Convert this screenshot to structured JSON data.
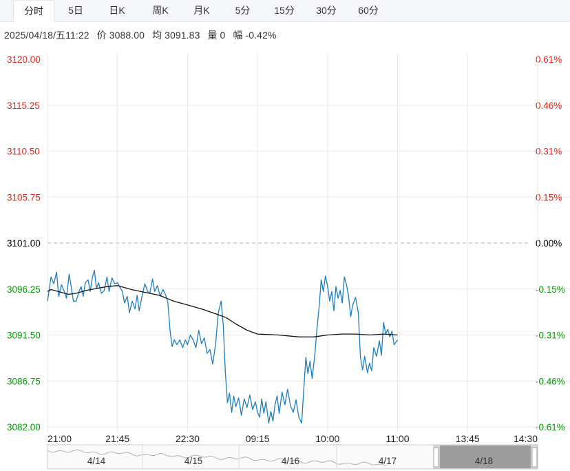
{
  "tabs": [
    {
      "label": "分时",
      "active": true
    },
    {
      "label": "5日",
      "active": false
    },
    {
      "label": "日K",
      "active": false
    },
    {
      "label": "周K",
      "active": false
    },
    {
      "label": "月K",
      "active": false
    },
    {
      "label": "5分",
      "active": false
    },
    {
      "label": "15分",
      "active": false
    },
    {
      "label": "30分",
      "active": false
    },
    {
      "label": "60分",
      "active": false
    }
  ],
  "info": {
    "datetime": "2025/04/18/五11:22",
    "price": "价 3088.00",
    "avg": "均 3091.83",
    "volume": "量 0",
    "change": "幅 -0.42%"
  },
  "colors": {
    "up": "#e2231a",
    "down": "#009900",
    "neutral": "#000000",
    "price_line": "#1a7cc1",
    "avg_line": "#111111",
    "grid": "#e8e8e8"
  },
  "chart_data": {
    "type": "line",
    "prev_close": 3101.0,
    "ylim": [
      3082.0,
      3120.0
    ],
    "y_ticks": [
      "3120.00",
      "3115.25",
      "3110.50",
      "3105.75",
      "3101.00",
      "3096.25",
      "3091.50",
      "3086.75",
      "3082.00"
    ],
    "pct_ticks": [
      "0.61%",
      "0.46%",
      "0.31%",
      "0.15%",
      "0.00%",
      "-0.15%",
      "-0.31%",
      "-0.46%",
      "-0.61%"
    ],
    "x_ticks": [
      "21:00",
      "21:45",
      "22:30",
      "09:15",
      "10:00",
      "11:00",
      "13:45",
      "14:30"
    ],
    "x_slots": [
      "21:00",
      "21:45",
      "22:30",
      "23:00/09:15",
      "10:00",
      "11:00",
      "13:45",
      "14:30"
    ],
    "series": [
      {
        "key": "price",
        "values": [
          [
            0,
            3095.0
          ],
          [
            0.05,
            3097.5
          ],
          [
            0.09,
            3096.8
          ],
          [
            0.13,
            3098.0
          ],
          [
            0.16,
            3095.5
          ],
          [
            0.2,
            3096.7
          ],
          [
            0.24,
            3096.0
          ],
          [
            0.27,
            3095.3
          ],
          [
            0.31,
            3097.8
          ],
          [
            0.34,
            3096.4
          ],
          [
            0.37,
            3095.0
          ],
          [
            0.41,
            3095.0
          ],
          [
            0.45,
            3096.0
          ],
          [
            0.48,
            3096.5
          ],
          [
            0.51,
            3095.5
          ],
          [
            0.54,
            3096.9
          ],
          [
            0.58,
            3097.2
          ],
          [
            0.61,
            3096.0
          ],
          [
            0.64,
            3097.4
          ],
          [
            0.67,
            3098.2
          ],
          [
            0.7,
            3096.3
          ],
          [
            0.73,
            3096.9
          ],
          [
            0.77,
            3095.8
          ],
          [
            0.81,
            3096.1
          ],
          [
            0.85,
            3097.5
          ],
          [
            0.88,
            3096.0
          ],
          [
            0.92,
            3097.4
          ],
          [
            0.96,
            3096.8
          ],
          [
            1.0,
            3096.9
          ],
          [
            1.03,
            3096.5
          ],
          [
            1.07,
            3096.0
          ],
          [
            1.1,
            3094.8
          ],
          [
            1.14,
            3095.5
          ],
          [
            1.17,
            3093.8
          ],
          [
            1.21,
            3095.0
          ],
          [
            1.25,
            3094.2
          ],
          [
            1.28,
            3095.6
          ],
          [
            1.31,
            3094.0
          ],
          [
            1.35,
            3095.5
          ],
          [
            1.39,
            3096.8
          ],
          [
            1.43,
            3096.0
          ],
          [
            1.46,
            3095.8
          ],
          [
            1.5,
            3097.3
          ],
          [
            1.53,
            3096.0
          ],
          [
            1.57,
            3096.6
          ],
          [
            1.61,
            3095.5
          ],
          [
            1.65,
            3096.2
          ],
          [
            1.69,
            3095.6
          ],
          [
            1.72,
            3094.8
          ],
          [
            1.75,
            3092.0
          ],
          [
            1.78,
            3090.3
          ],
          [
            1.81,
            3091.0
          ],
          [
            1.85,
            3090.5
          ],
          [
            1.89,
            3091.0
          ],
          [
            1.93,
            3090.2
          ],
          [
            1.97,
            3091.0
          ],
          [
            2.0,
            3090.5
          ],
          [
            2.04,
            3091.5
          ],
          [
            2.08,
            3091.0
          ],
          [
            2.12,
            3090.2
          ],
          [
            2.16,
            3092.0
          ],
          [
            2.2,
            3090.6
          ],
          [
            2.24,
            3091.2
          ],
          [
            2.28,
            3089.6
          ],
          [
            2.32,
            3090.0
          ],
          [
            2.36,
            3088.5
          ],
          [
            2.4,
            3090.5
          ],
          [
            2.44,
            3093.8
          ],
          [
            2.48,
            3095.0
          ],
          [
            2.51,
            3092.5
          ],
          [
            2.54,
            3087.7
          ],
          [
            2.57,
            3084.5
          ],
          [
            2.6,
            3085.5
          ],
          [
            2.63,
            3083.5
          ],
          [
            2.66,
            3085.2
          ],
          [
            2.69,
            3084.1
          ],
          [
            2.73,
            3085.0
          ],
          [
            2.77,
            3083.2
          ],
          [
            2.81,
            3084.9
          ],
          [
            2.85,
            3084.0
          ],
          [
            2.89,
            3085.3
          ],
          [
            2.93,
            3083.8
          ],
          [
            2.97,
            3084.6
          ],
          [
            3.0,
            3083.5
          ],
          [
            3.03,
            3083.0
          ],
          [
            3.06,
            3084.9
          ],
          [
            3.09,
            3083.4
          ],
          [
            3.12,
            3084.6
          ],
          [
            3.16,
            3082.4
          ],
          [
            3.19,
            3083.6
          ],
          [
            3.22,
            3082.6
          ],
          [
            3.25,
            3084.3
          ],
          [
            3.28,
            3085.2
          ],
          [
            3.31,
            3083.4
          ],
          [
            3.35,
            3085.6
          ],
          [
            3.39,
            3084.3
          ],
          [
            3.43,
            3085.9
          ],
          [
            3.47,
            3084.2
          ],
          [
            3.51,
            3083.5
          ],
          [
            3.55,
            3084.8
          ],
          [
            3.59,
            3083.0
          ],
          [
            3.63,
            3082.4
          ],
          [
            3.66,
            3085.8
          ],
          [
            3.69,
            3089.2
          ],
          [
            3.72,
            3087.5
          ],
          [
            3.75,
            3088.8
          ],
          [
            3.78,
            3087.0
          ],
          [
            3.82,
            3089.6
          ],
          [
            3.85,
            3092.2
          ],
          [
            3.88,
            3094.4
          ],
          [
            3.91,
            3097.2
          ],
          [
            3.94,
            3096.0
          ],
          [
            3.97,
            3097.6
          ],
          [
            4.0,
            3096.6
          ],
          [
            4.03,
            3095.0
          ],
          [
            4.06,
            3096.0
          ],
          [
            4.09,
            3094.0
          ],
          [
            4.12,
            3096.5
          ],
          [
            4.15,
            3095.3
          ],
          [
            4.18,
            3096.1
          ],
          [
            4.21,
            3094.8
          ],
          [
            4.24,
            3097.5
          ],
          [
            4.27,
            3096.7
          ],
          [
            4.3,
            3095.6
          ],
          [
            4.33,
            3093.4
          ],
          [
            4.36,
            3094.6
          ],
          [
            4.4,
            3095.4
          ],
          [
            4.44,
            3093.8
          ],
          [
            4.47,
            3089.2
          ],
          [
            4.5,
            3087.9
          ],
          [
            4.53,
            3089.3
          ],
          [
            4.57,
            3087.6
          ],
          [
            4.6,
            3088.6
          ],
          [
            4.63,
            3087.8
          ],
          [
            4.66,
            3090.2
          ],
          [
            4.7,
            3089.3
          ],
          [
            4.74,
            3090.9
          ],
          [
            4.77,
            3089.4
          ],
          [
            4.8,
            3092.8
          ],
          [
            4.83,
            3091.6
          ],
          [
            4.86,
            3092.1
          ],
          [
            4.89,
            3091.3
          ],
          [
            4.92,
            3091.9
          ],
          [
            4.95,
            3090.5
          ],
          [
            5.0,
            3091.0
          ]
        ]
      },
      {
        "key": "avg",
        "values": [
          [
            0,
            3096.0
          ],
          [
            0.05,
            3096.2
          ],
          [
            0.15,
            3096.0
          ],
          [
            0.3,
            3095.7
          ],
          [
            0.4,
            3095.8
          ],
          [
            0.55,
            3096.1
          ],
          [
            0.7,
            3096.3
          ],
          [
            0.85,
            3096.5
          ],
          [
            1.0,
            3096.6
          ],
          [
            1.2,
            3096.2
          ],
          [
            1.4,
            3095.9
          ],
          [
            1.6,
            3095.6
          ],
          [
            1.8,
            3095.0
          ],
          [
            2.0,
            3094.6
          ],
          [
            2.2,
            3094.2
          ],
          [
            2.4,
            3093.7
          ],
          [
            2.55,
            3093.3
          ],
          [
            2.7,
            3092.6
          ],
          [
            2.85,
            3092.0
          ],
          [
            3.0,
            3091.6
          ],
          [
            3.3,
            3091.5
          ],
          [
            3.6,
            3091.3
          ],
          [
            3.8,
            3091.3
          ],
          [
            4.0,
            3091.5
          ],
          [
            4.2,
            3091.6
          ],
          [
            4.4,
            3091.6
          ],
          [
            4.6,
            3091.5
          ],
          [
            4.8,
            3091.6
          ],
          [
            5.0,
            3091.5
          ]
        ]
      }
    ]
  },
  "navigator": {
    "labels": [
      "4/14",
      "4/15",
      "4/16",
      "4/17",
      "4/18"
    ]
  }
}
